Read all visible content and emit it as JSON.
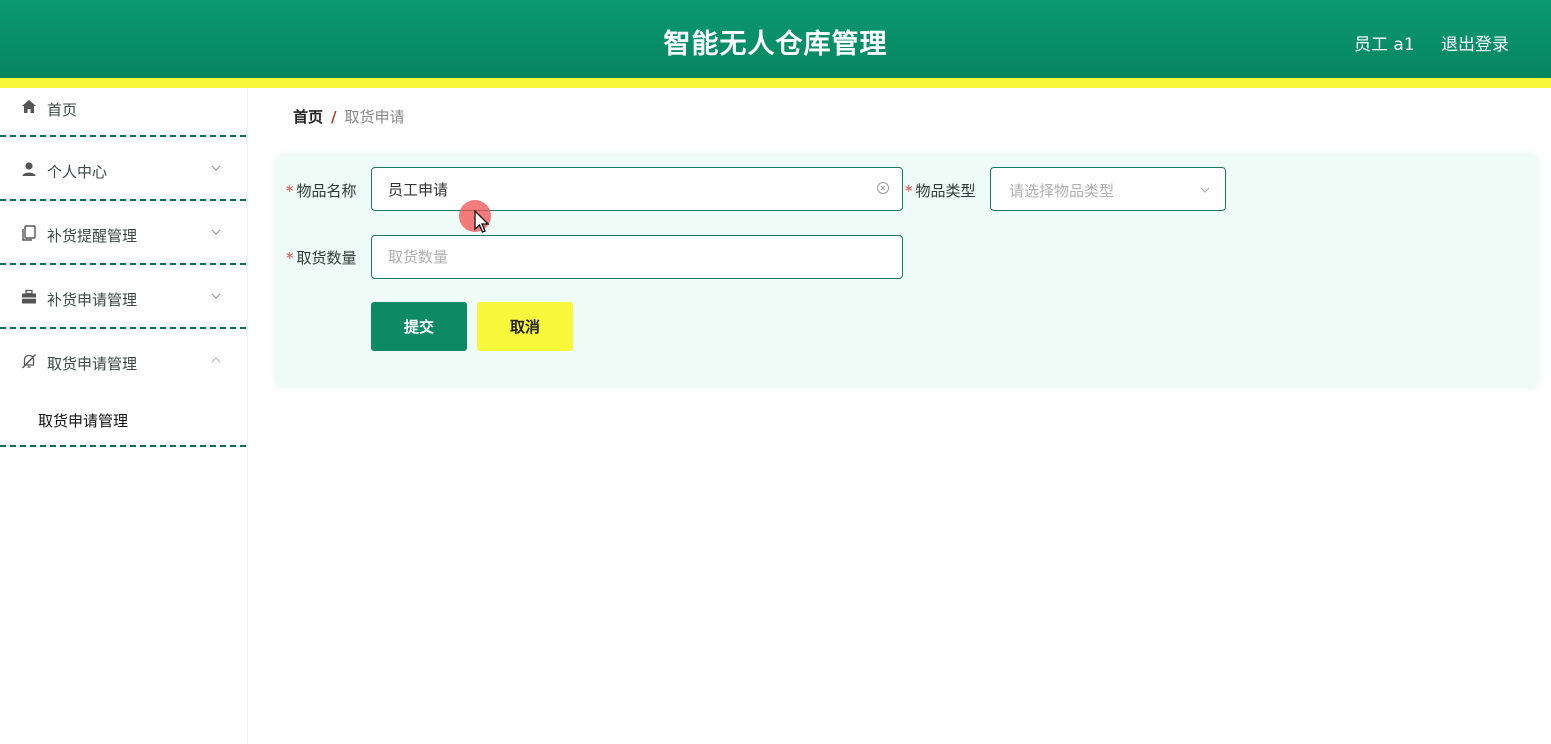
{
  "header": {
    "title": "智能无人仓库管理",
    "user": "员工 a1",
    "logout": "退出登录"
  },
  "sidebar": {
    "items": [
      {
        "label": "首页",
        "icon": "home-icon"
      },
      {
        "label": "个人中心",
        "icon": "user-icon"
      },
      {
        "label": "补货提醒管理",
        "icon": "copy-icon"
      },
      {
        "label": "补货申请管理",
        "icon": "briefcase-icon"
      },
      {
        "label": "取货申请管理",
        "icon": "bell-off-icon"
      }
    ],
    "sub_item": "取货申请管理"
  },
  "breadcrumb": {
    "home": "首页",
    "separator": "/",
    "current": "取货申请"
  },
  "form": {
    "name_label": "物品名称",
    "name_value": "员工申请",
    "type_label": "物品类型",
    "type_placeholder": "请选择物品类型",
    "qty_label": "取货数量",
    "qty_placeholder": "取货数量",
    "required_mark": "*",
    "submit_label": "提交",
    "cancel_label": "取消"
  },
  "colors": {
    "header": "#0a9a72",
    "accent_yellow": "#f7f73c",
    "submit": "#0d8a64",
    "required": "#e2493b"
  }
}
